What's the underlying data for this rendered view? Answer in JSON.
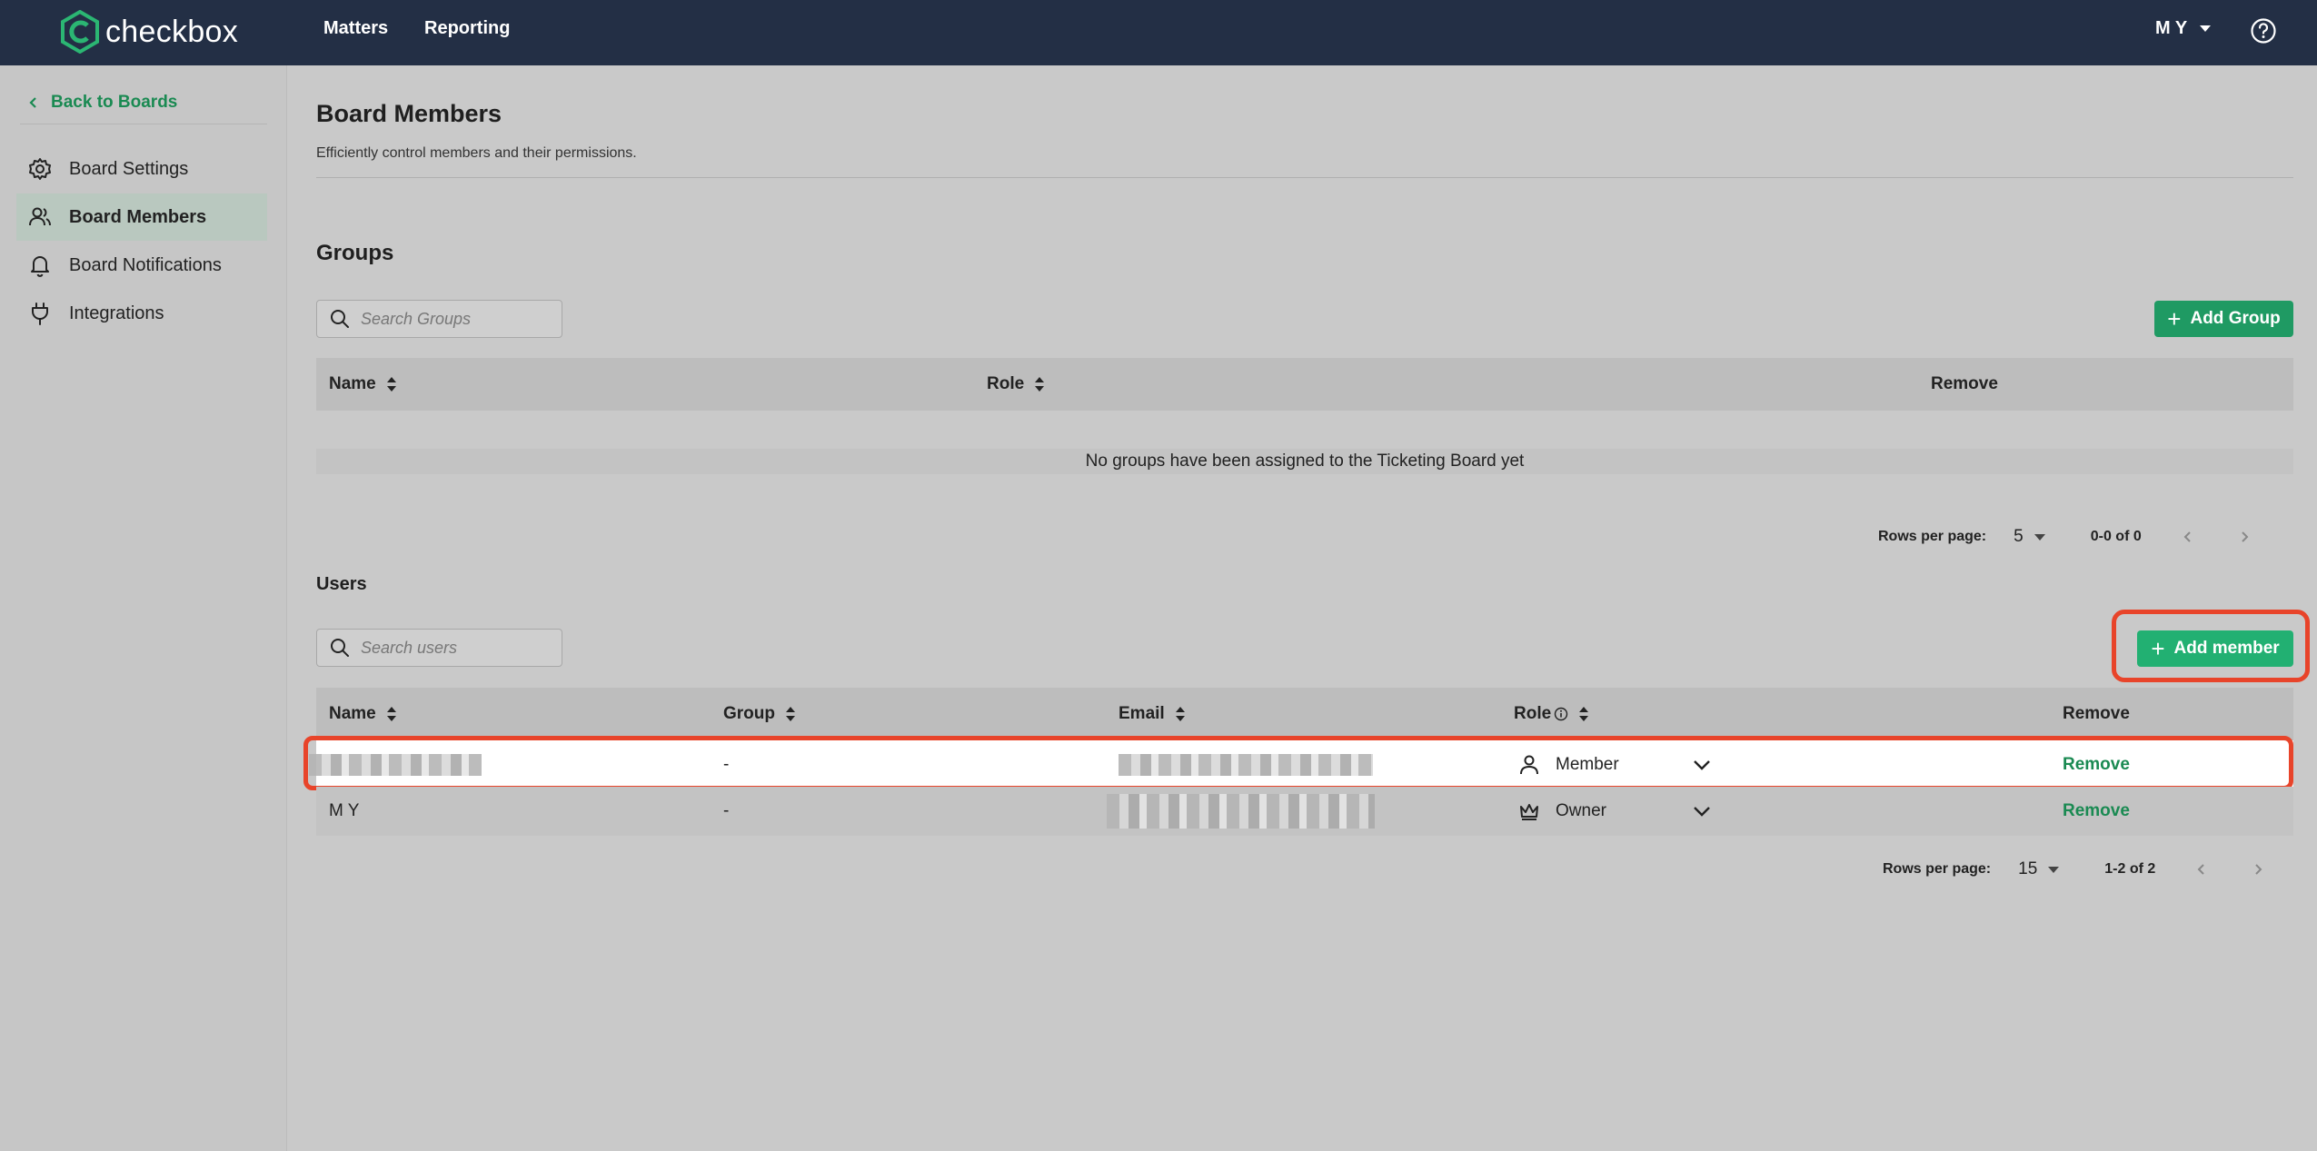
{
  "colors": {
    "topbar": "#232f45",
    "brand_green": "#1a8a52",
    "button_green": "#22a96b",
    "highlight": "#e8442a"
  },
  "header": {
    "logo_text": "checkbox",
    "nav": [
      "Matters",
      "Reporting"
    ],
    "user_initials": "M Y"
  },
  "sidebar": {
    "back_label": "Back to Boards",
    "items": [
      {
        "label": "Board Settings",
        "icon": "gear-icon"
      },
      {
        "label": "Board Members",
        "icon": "users-icon",
        "active": true
      },
      {
        "label": "Board Notifications",
        "icon": "bell-icon"
      },
      {
        "label": "Integrations",
        "icon": "plug-icon"
      }
    ]
  },
  "page": {
    "title": "Board Members",
    "subtitle": "Efficiently control members and their permissions."
  },
  "groups": {
    "title": "Groups",
    "search_placeholder": "Search Groups",
    "add_label": "Add Group",
    "columns": [
      "Name",
      "Role",
      "Remove"
    ],
    "empty_text": "No groups have been assigned to the Ticketing Board yet",
    "rows_per_page_label": "Rows per page:",
    "rows_per_page": "5",
    "range": "0-0 of 0"
  },
  "users": {
    "title": "Users",
    "search_placeholder": "Search users",
    "add_label": "Add member",
    "columns": [
      "Name",
      "Group",
      "Email",
      "Role",
      "Remove"
    ],
    "rows": [
      {
        "name": "",
        "group": "-",
        "email": "",
        "role": "Member",
        "role_icon": "person-icon",
        "remove": "Remove"
      },
      {
        "name": "M Y",
        "group": "-",
        "email": "",
        "role": "Owner",
        "role_icon": "crown-icon",
        "remove": "Remove"
      }
    ],
    "rows_per_page_label": "Rows per page:",
    "rows_per_page": "15",
    "range": "1-2 of 2"
  }
}
